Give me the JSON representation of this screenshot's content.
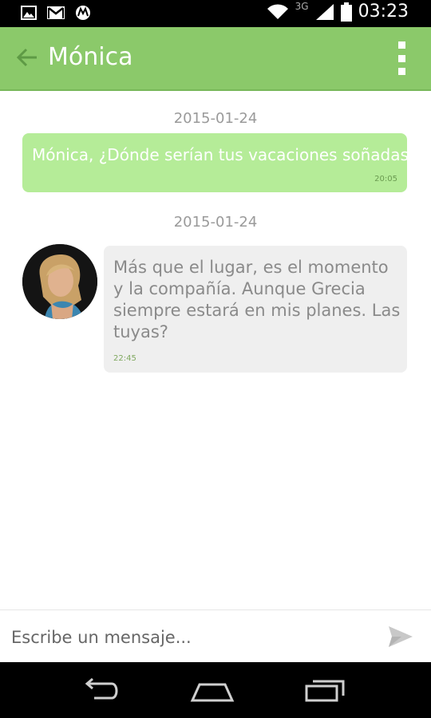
{
  "status_bar": {
    "network_label": "3G",
    "time": "03:23",
    "icons": [
      "image-notification-icon",
      "gmail-icon",
      "motorola-icon",
      "wifi-icon",
      "signal-icon",
      "battery-icon"
    ]
  },
  "app_bar": {
    "title": "Mónica",
    "color": "#8bc96a",
    "back_icon": "back-arrow-icon",
    "menu_icon": "overflow-menu-icon"
  },
  "messages": [
    {
      "date": "2015-01-24",
      "direction": "outgoing",
      "text": "Mónica, ¿Dónde serían tus vacaciones soñadas?",
      "time": "20:05",
      "bubble_color": "#b5ec98"
    },
    {
      "date": "2015-01-24",
      "direction": "incoming",
      "text": "Más que el lugar, es el momento y la compañía. Aunque Grecia siempre estará en mis planes. Las tuyas?",
      "time": "22:45",
      "bubble_color": "#efefef"
    }
  ],
  "compose": {
    "placeholder": "Escribe un mensaje...",
    "send_icon": "send-icon"
  },
  "nav_bar": {
    "icons": [
      "back-icon",
      "home-icon",
      "recents-icon"
    ]
  }
}
